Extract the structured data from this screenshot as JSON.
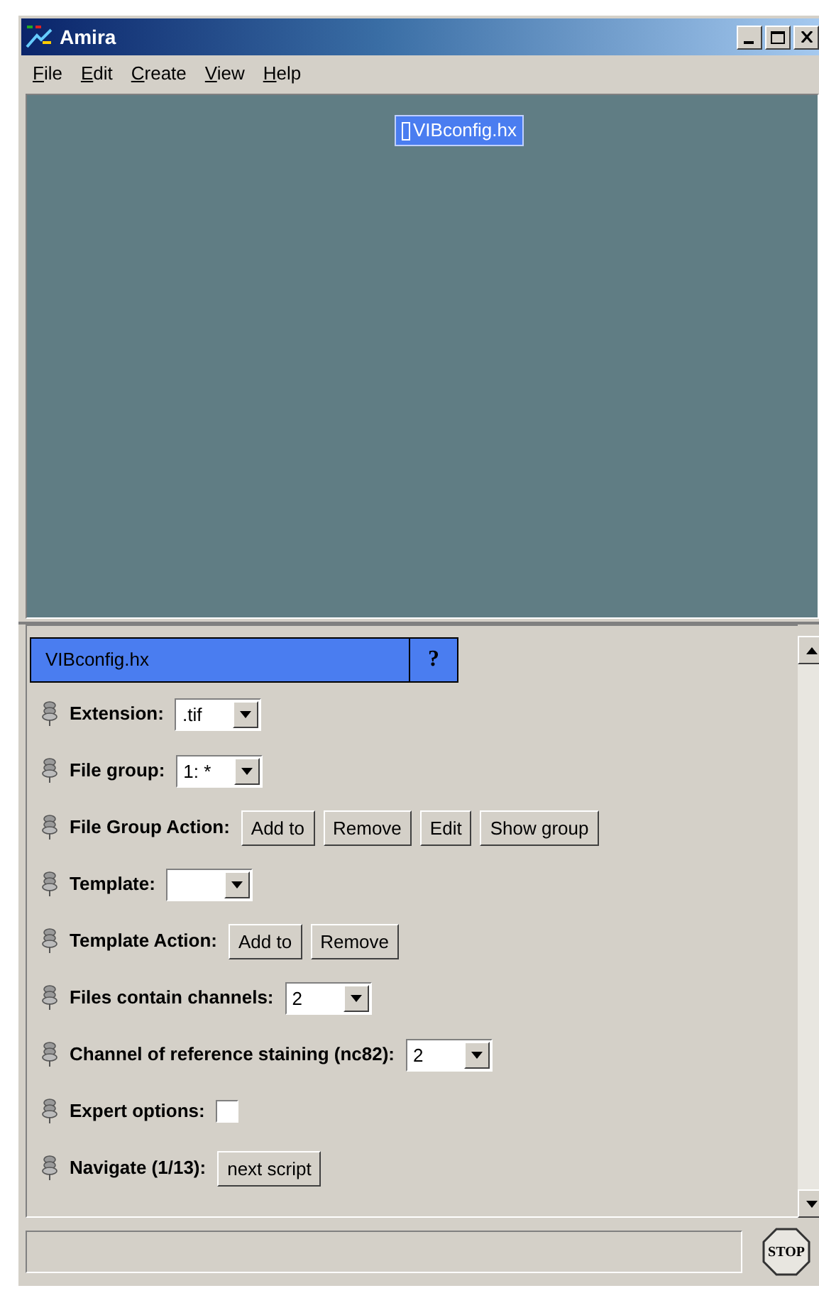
{
  "window": {
    "title": "Amira"
  },
  "menu": [
    "File",
    "Edit",
    "Create",
    "View",
    "Help"
  ],
  "viewer": {
    "object_label": "VIBconfig.hx",
    "selected": true
  },
  "module": {
    "title": "VIBconfig.hx",
    "help": "?"
  },
  "ports": [
    {
      "kind": "dropdown",
      "label": "Extension:",
      "value": ".tif"
    },
    {
      "kind": "dropdown",
      "label": "File group:",
      "value": "1: *"
    },
    {
      "kind": "buttons",
      "label": "File Group Action:",
      "buttons": [
        "Add to",
        "Remove",
        "Edit",
        "Show group"
      ]
    },
    {
      "kind": "dropdown",
      "label": "Template:"
    },
    {
      "kind": "buttons",
      "label": "Template Action:",
      "buttons": [
        "Add to",
        "Remove"
      ]
    },
    {
      "kind": "dropdown",
      "label": "Files contain channels:",
      "value": "2"
    },
    {
      "kind": "dropdown",
      "label": "Channel of reference staining (nc82):",
      "value": "2"
    },
    {
      "kind": "checkbox",
      "label": "Expert options:",
      "checked": false
    },
    {
      "kind": "buttons",
      "label": "Navigate (1/13):",
      "buttons": [
        "next script"
      ]
    }
  ],
  "stop_button": "STOP"
}
